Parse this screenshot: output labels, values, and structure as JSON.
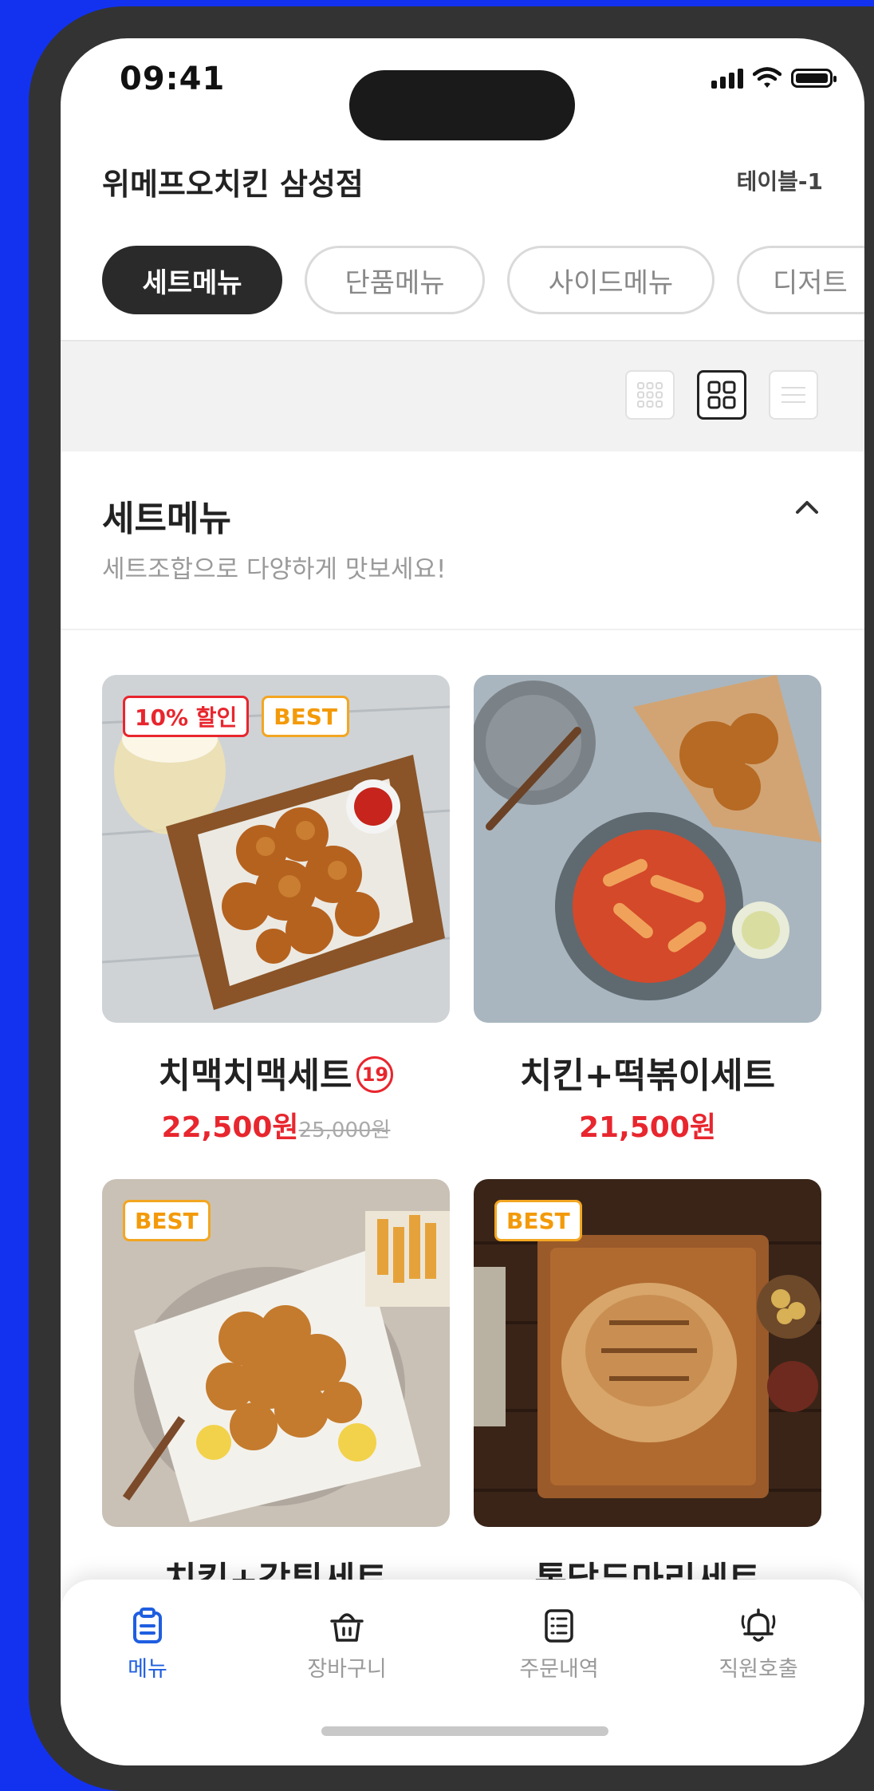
{
  "status": {
    "time": "09:41"
  },
  "header": {
    "store_name": "위메프오치킨 삼성점",
    "table": "테이블-1"
  },
  "tabs": [
    {
      "label": "세트메뉴",
      "active": true
    },
    {
      "label": "단품메뉴",
      "active": false
    },
    {
      "label": "사이드메뉴",
      "active": false
    },
    {
      "label": "디저트",
      "active": false
    }
  ],
  "view_modes": [
    {
      "icon": "grid-3-icon",
      "active": false
    },
    {
      "icon": "grid-2-icon",
      "active": true
    },
    {
      "icon": "list-icon",
      "active": false
    }
  ],
  "section": {
    "title": "세트메뉴",
    "subtitle": "세트조합으로 다양하게 맛보세요!"
  },
  "products": [
    {
      "name": "치맥치맥세트",
      "age_badge": "19",
      "price": "22,500원",
      "original_price": "25,000원",
      "badges": [
        "10% 할인",
        "BEST"
      ]
    },
    {
      "name": "치킨+떡볶이세트",
      "price": "21,500원",
      "badges": []
    },
    {
      "name": "치킨+감튀세트",
      "badges": [
        "BEST"
      ]
    },
    {
      "name": "통닭두마리세트",
      "badges": [
        "BEST"
      ]
    }
  ],
  "bottom_nav": [
    {
      "label": "메뉴",
      "icon": "clipboard-icon",
      "active": true
    },
    {
      "label": "장바구니",
      "icon": "basket-icon",
      "active": false
    },
    {
      "label": "주문내역",
      "icon": "order-list-icon",
      "active": false
    },
    {
      "label": "직원호출",
      "icon": "bell-icon",
      "active": false
    }
  ],
  "colors": {
    "accent": "#1f5ee0",
    "sale": "#e8262e",
    "best": "#f3a622",
    "background": "#1332f0"
  }
}
